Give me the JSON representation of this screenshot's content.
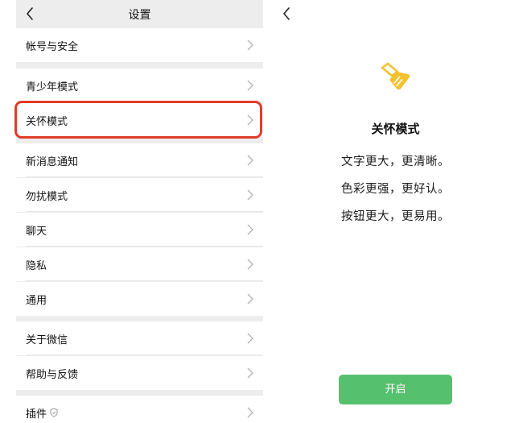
{
  "settings": {
    "title": "设置",
    "back_icon": "back-arrow-icon",
    "chevron_icon": "chevron-right-icon",
    "rows": [
      {
        "id": "account-security",
        "label": "帐号与安全"
      },
      {
        "id": "youth-mode",
        "label": "青少年模式"
      },
      {
        "id": "care-mode",
        "label": "关怀模式",
        "highlighted": true
      },
      {
        "id": "new-message-notification",
        "label": "新消息通知"
      },
      {
        "id": "do-not-disturb",
        "label": "勿扰模式"
      },
      {
        "id": "chat",
        "label": "聊天"
      },
      {
        "id": "privacy",
        "label": "隐私"
      },
      {
        "id": "general",
        "label": "通用"
      },
      {
        "id": "about-wechat",
        "label": "关于微信"
      },
      {
        "id": "help-feedback",
        "label": "帮助与反馈"
      },
      {
        "id": "plugins",
        "label": "插件",
        "icon": "shield-icon"
      }
    ],
    "highlight_color": "#e03c2b"
  },
  "care_mode": {
    "back_icon": "back-arrow-icon",
    "icon": "broom-icon",
    "icon_color": "#f2c230",
    "title": "关怀模式",
    "benefits": [
      "文字更大，更清晰。",
      "色彩更强，更好认。",
      "按钮更大，更易用。"
    ],
    "button_label": "开启",
    "button_color": "#55c06d"
  }
}
